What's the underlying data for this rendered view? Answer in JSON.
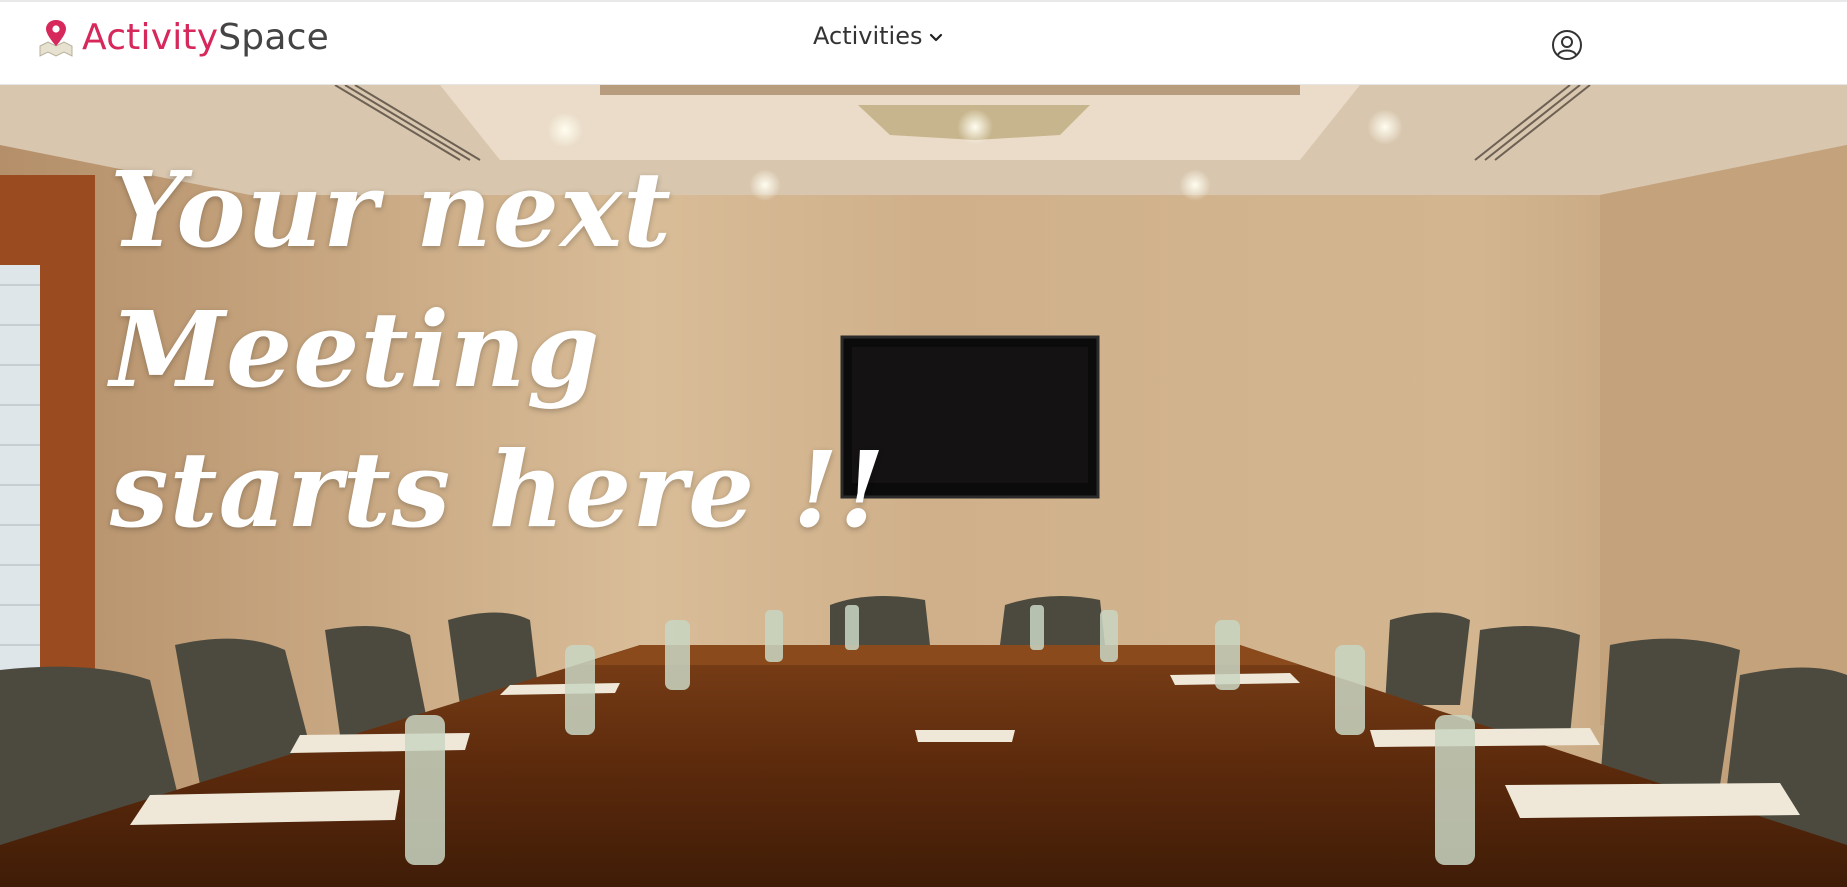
{
  "brand": {
    "part1": "Activity",
    "part2": "Space",
    "logo_icon": "map-pin-icon",
    "color1": "#d6285a",
    "color2": "#444444"
  },
  "nav": {
    "menu_label": "Activities",
    "menu_icon": "chevron-down-icon"
  },
  "user": {
    "icon": "user-circle-icon"
  },
  "hero": {
    "title_line1": "Your next Meeting",
    "title_line2": "starts here !!",
    "image": "conference-room-photo"
  }
}
